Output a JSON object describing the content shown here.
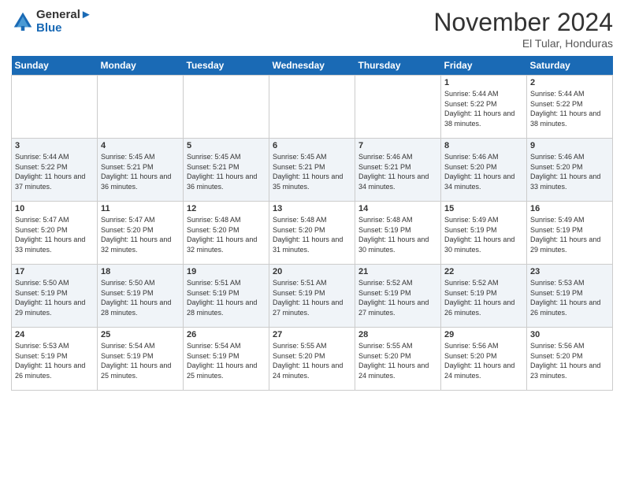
{
  "logo": {
    "line1": "General",
    "line2": "Blue"
  },
  "header": {
    "month": "November 2024",
    "location": "El Tular, Honduras"
  },
  "days_of_week": [
    "Sunday",
    "Monday",
    "Tuesday",
    "Wednesday",
    "Thursday",
    "Friday",
    "Saturday"
  ],
  "weeks": [
    [
      {
        "day": "",
        "sunrise": "",
        "sunset": "",
        "daylight": ""
      },
      {
        "day": "",
        "sunrise": "",
        "sunset": "",
        "daylight": ""
      },
      {
        "day": "",
        "sunrise": "",
        "sunset": "",
        "daylight": ""
      },
      {
        "day": "",
        "sunrise": "",
        "sunset": "",
        "daylight": ""
      },
      {
        "day": "",
        "sunrise": "",
        "sunset": "",
        "daylight": ""
      },
      {
        "day": "1",
        "sunrise": "Sunrise: 5:44 AM",
        "sunset": "Sunset: 5:22 PM",
        "daylight": "Daylight: 11 hours and 38 minutes."
      },
      {
        "day": "2",
        "sunrise": "Sunrise: 5:44 AM",
        "sunset": "Sunset: 5:22 PM",
        "daylight": "Daylight: 11 hours and 38 minutes."
      }
    ],
    [
      {
        "day": "3",
        "sunrise": "Sunrise: 5:44 AM",
        "sunset": "Sunset: 5:22 PM",
        "daylight": "Daylight: 11 hours and 37 minutes."
      },
      {
        "day": "4",
        "sunrise": "Sunrise: 5:45 AM",
        "sunset": "Sunset: 5:21 PM",
        "daylight": "Daylight: 11 hours and 36 minutes."
      },
      {
        "day": "5",
        "sunrise": "Sunrise: 5:45 AM",
        "sunset": "Sunset: 5:21 PM",
        "daylight": "Daylight: 11 hours and 36 minutes."
      },
      {
        "day": "6",
        "sunrise": "Sunrise: 5:45 AM",
        "sunset": "Sunset: 5:21 PM",
        "daylight": "Daylight: 11 hours and 35 minutes."
      },
      {
        "day": "7",
        "sunrise": "Sunrise: 5:46 AM",
        "sunset": "Sunset: 5:21 PM",
        "daylight": "Daylight: 11 hours and 34 minutes."
      },
      {
        "day": "8",
        "sunrise": "Sunrise: 5:46 AM",
        "sunset": "Sunset: 5:20 PM",
        "daylight": "Daylight: 11 hours and 34 minutes."
      },
      {
        "day": "9",
        "sunrise": "Sunrise: 5:46 AM",
        "sunset": "Sunset: 5:20 PM",
        "daylight": "Daylight: 11 hours and 33 minutes."
      }
    ],
    [
      {
        "day": "10",
        "sunrise": "Sunrise: 5:47 AM",
        "sunset": "Sunset: 5:20 PM",
        "daylight": "Daylight: 11 hours and 33 minutes."
      },
      {
        "day": "11",
        "sunrise": "Sunrise: 5:47 AM",
        "sunset": "Sunset: 5:20 PM",
        "daylight": "Daylight: 11 hours and 32 minutes."
      },
      {
        "day": "12",
        "sunrise": "Sunrise: 5:48 AM",
        "sunset": "Sunset: 5:20 PM",
        "daylight": "Daylight: 11 hours and 32 minutes."
      },
      {
        "day": "13",
        "sunrise": "Sunrise: 5:48 AM",
        "sunset": "Sunset: 5:20 PM",
        "daylight": "Daylight: 11 hours and 31 minutes."
      },
      {
        "day": "14",
        "sunrise": "Sunrise: 5:48 AM",
        "sunset": "Sunset: 5:19 PM",
        "daylight": "Daylight: 11 hours and 30 minutes."
      },
      {
        "day": "15",
        "sunrise": "Sunrise: 5:49 AM",
        "sunset": "Sunset: 5:19 PM",
        "daylight": "Daylight: 11 hours and 30 minutes."
      },
      {
        "day": "16",
        "sunrise": "Sunrise: 5:49 AM",
        "sunset": "Sunset: 5:19 PM",
        "daylight": "Daylight: 11 hours and 29 minutes."
      }
    ],
    [
      {
        "day": "17",
        "sunrise": "Sunrise: 5:50 AM",
        "sunset": "Sunset: 5:19 PM",
        "daylight": "Daylight: 11 hours and 29 minutes."
      },
      {
        "day": "18",
        "sunrise": "Sunrise: 5:50 AM",
        "sunset": "Sunset: 5:19 PM",
        "daylight": "Daylight: 11 hours and 28 minutes."
      },
      {
        "day": "19",
        "sunrise": "Sunrise: 5:51 AM",
        "sunset": "Sunset: 5:19 PM",
        "daylight": "Daylight: 11 hours and 28 minutes."
      },
      {
        "day": "20",
        "sunrise": "Sunrise: 5:51 AM",
        "sunset": "Sunset: 5:19 PM",
        "daylight": "Daylight: 11 hours and 27 minutes."
      },
      {
        "day": "21",
        "sunrise": "Sunrise: 5:52 AM",
        "sunset": "Sunset: 5:19 PM",
        "daylight": "Daylight: 11 hours and 27 minutes."
      },
      {
        "day": "22",
        "sunrise": "Sunrise: 5:52 AM",
        "sunset": "Sunset: 5:19 PM",
        "daylight": "Daylight: 11 hours and 26 minutes."
      },
      {
        "day": "23",
        "sunrise": "Sunrise: 5:53 AM",
        "sunset": "Sunset: 5:19 PM",
        "daylight": "Daylight: 11 hours and 26 minutes."
      }
    ],
    [
      {
        "day": "24",
        "sunrise": "Sunrise: 5:53 AM",
        "sunset": "Sunset: 5:19 PM",
        "daylight": "Daylight: 11 hours and 26 minutes."
      },
      {
        "day": "25",
        "sunrise": "Sunrise: 5:54 AM",
        "sunset": "Sunset: 5:19 PM",
        "daylight": "Daylight: 11 hours and 25 minutes."
      },
      {
        "day": "26",
        "sunrise": "Sunrise: 5:54 AM",
        "sunset": "Sunset: 5:19 PM",
        "daylight": "Daylight: 11 hours and 25 minutes."
      },
      {
        "day": "27",
        "sunrise": "Sunrise: 5:55 AM",
        "sunset": "Sunset: 5:20 PM",
        "daylight": "Daylight: 11 hours and 24 minutes."
      },
      {
        "day": "28",
        "sunrise": "Sunrise: 5:55 AM",
        "sunset": "Sunset: 5:20 PM",
        "daylight": "Daylight: 11 hours and 24 minutes."
      },
      {
        "day": "29",
        "sunrise": "Sunrise: 5:56 AM",
        "sunset": "Sunset: 5:20 PM",
        "daylight": "Daylight: 11 hours and 24 minutes."
      },
      {
        "day": "30",
        "sunrise": "Sunrise: 5:56 AM",
        "sunset": "Sunset: 5:20 PM",
        "daylight": "Daylight: 11 hours and 23 minutes."
      }
    ]
  ]
}
